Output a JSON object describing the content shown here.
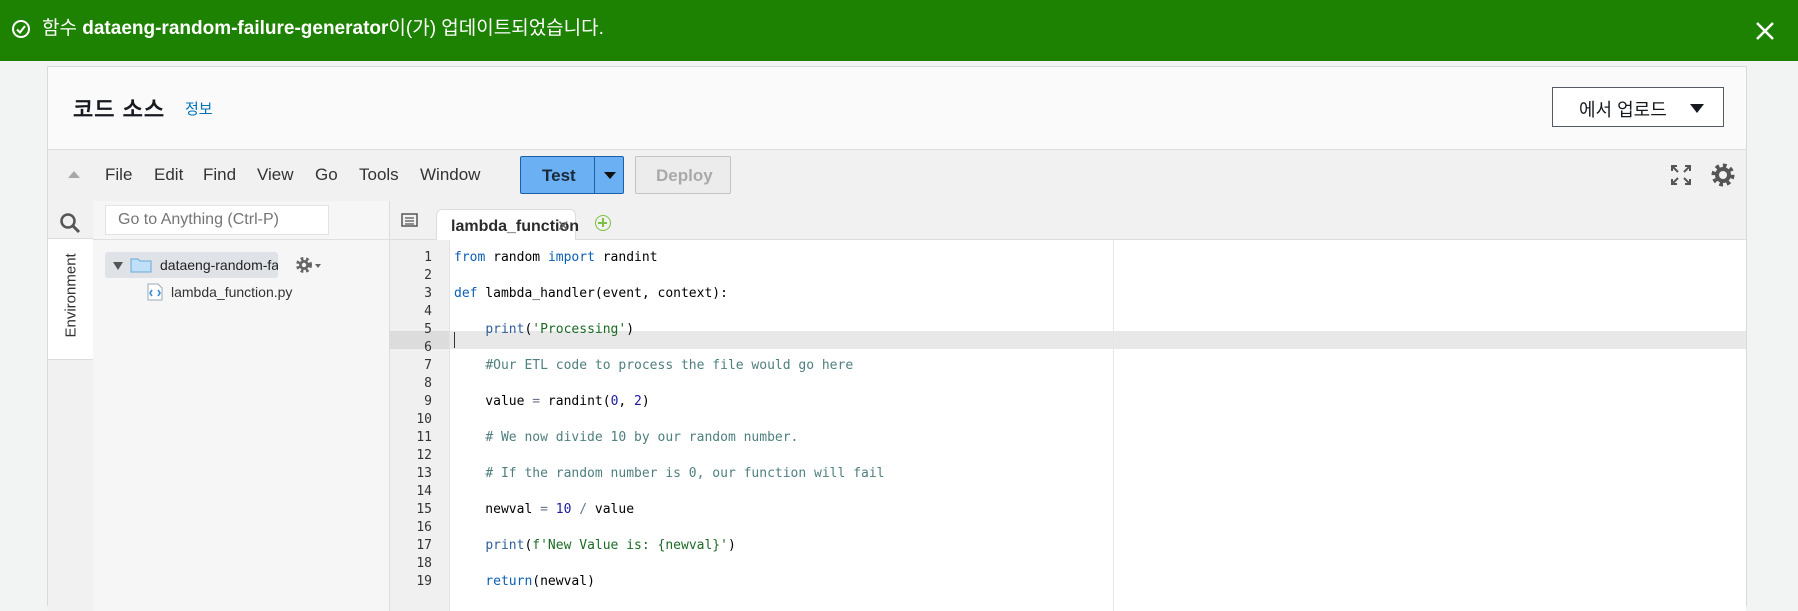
{
  "banner": {
    "prefix": "함수 ",
    "function_name": "dataeng-random-failure-generator",
    "suffix": "이(가) 업데이트되었습니다.",
    "color": "#1d8102"
  },
  "panel": {
    "title": "코드 소스",
    "info_link": "정보",
    "upload_label": "에서 업로드"
  },
  "toolbar": {
    "menus": [
      "File",
      "Edit",
      "Find",
      "View",
      "Go",
      "Tools",
      "Window"
    ],
    "test_label": "Test",
    "deploy_label": "Deploy"
  },
  "sidebar": {
    "search_placeholder": "Go to Anything (Ctrl-P)",
    "environment_tab": "Environment",
    "folder_name": "dataeng-random-failure-generator",
    "file_name": "lambda_function.py"
  },
  "editor": {
    "tab_label": "lambda_function",
    "active_line": 6,
    "lines": [
      "from random import randint",
      "",
      "def lambda_handler(event, context):",
      "",
      "    print('Processing')",
      "",
      "    #Our ETL code to process the file would go here",
      "",
      "    value = randint(0, 2)",
      "",
      "    # We now divide 10 by our random number.",
      "",
      "    # If the random number is 0, our function will fail",
      "",
      "    newval = 10 / value",
      "",
      "    print(f'New Value is: {newval}')",
      "",
      "    return(newval)"
    ]
  }
}
